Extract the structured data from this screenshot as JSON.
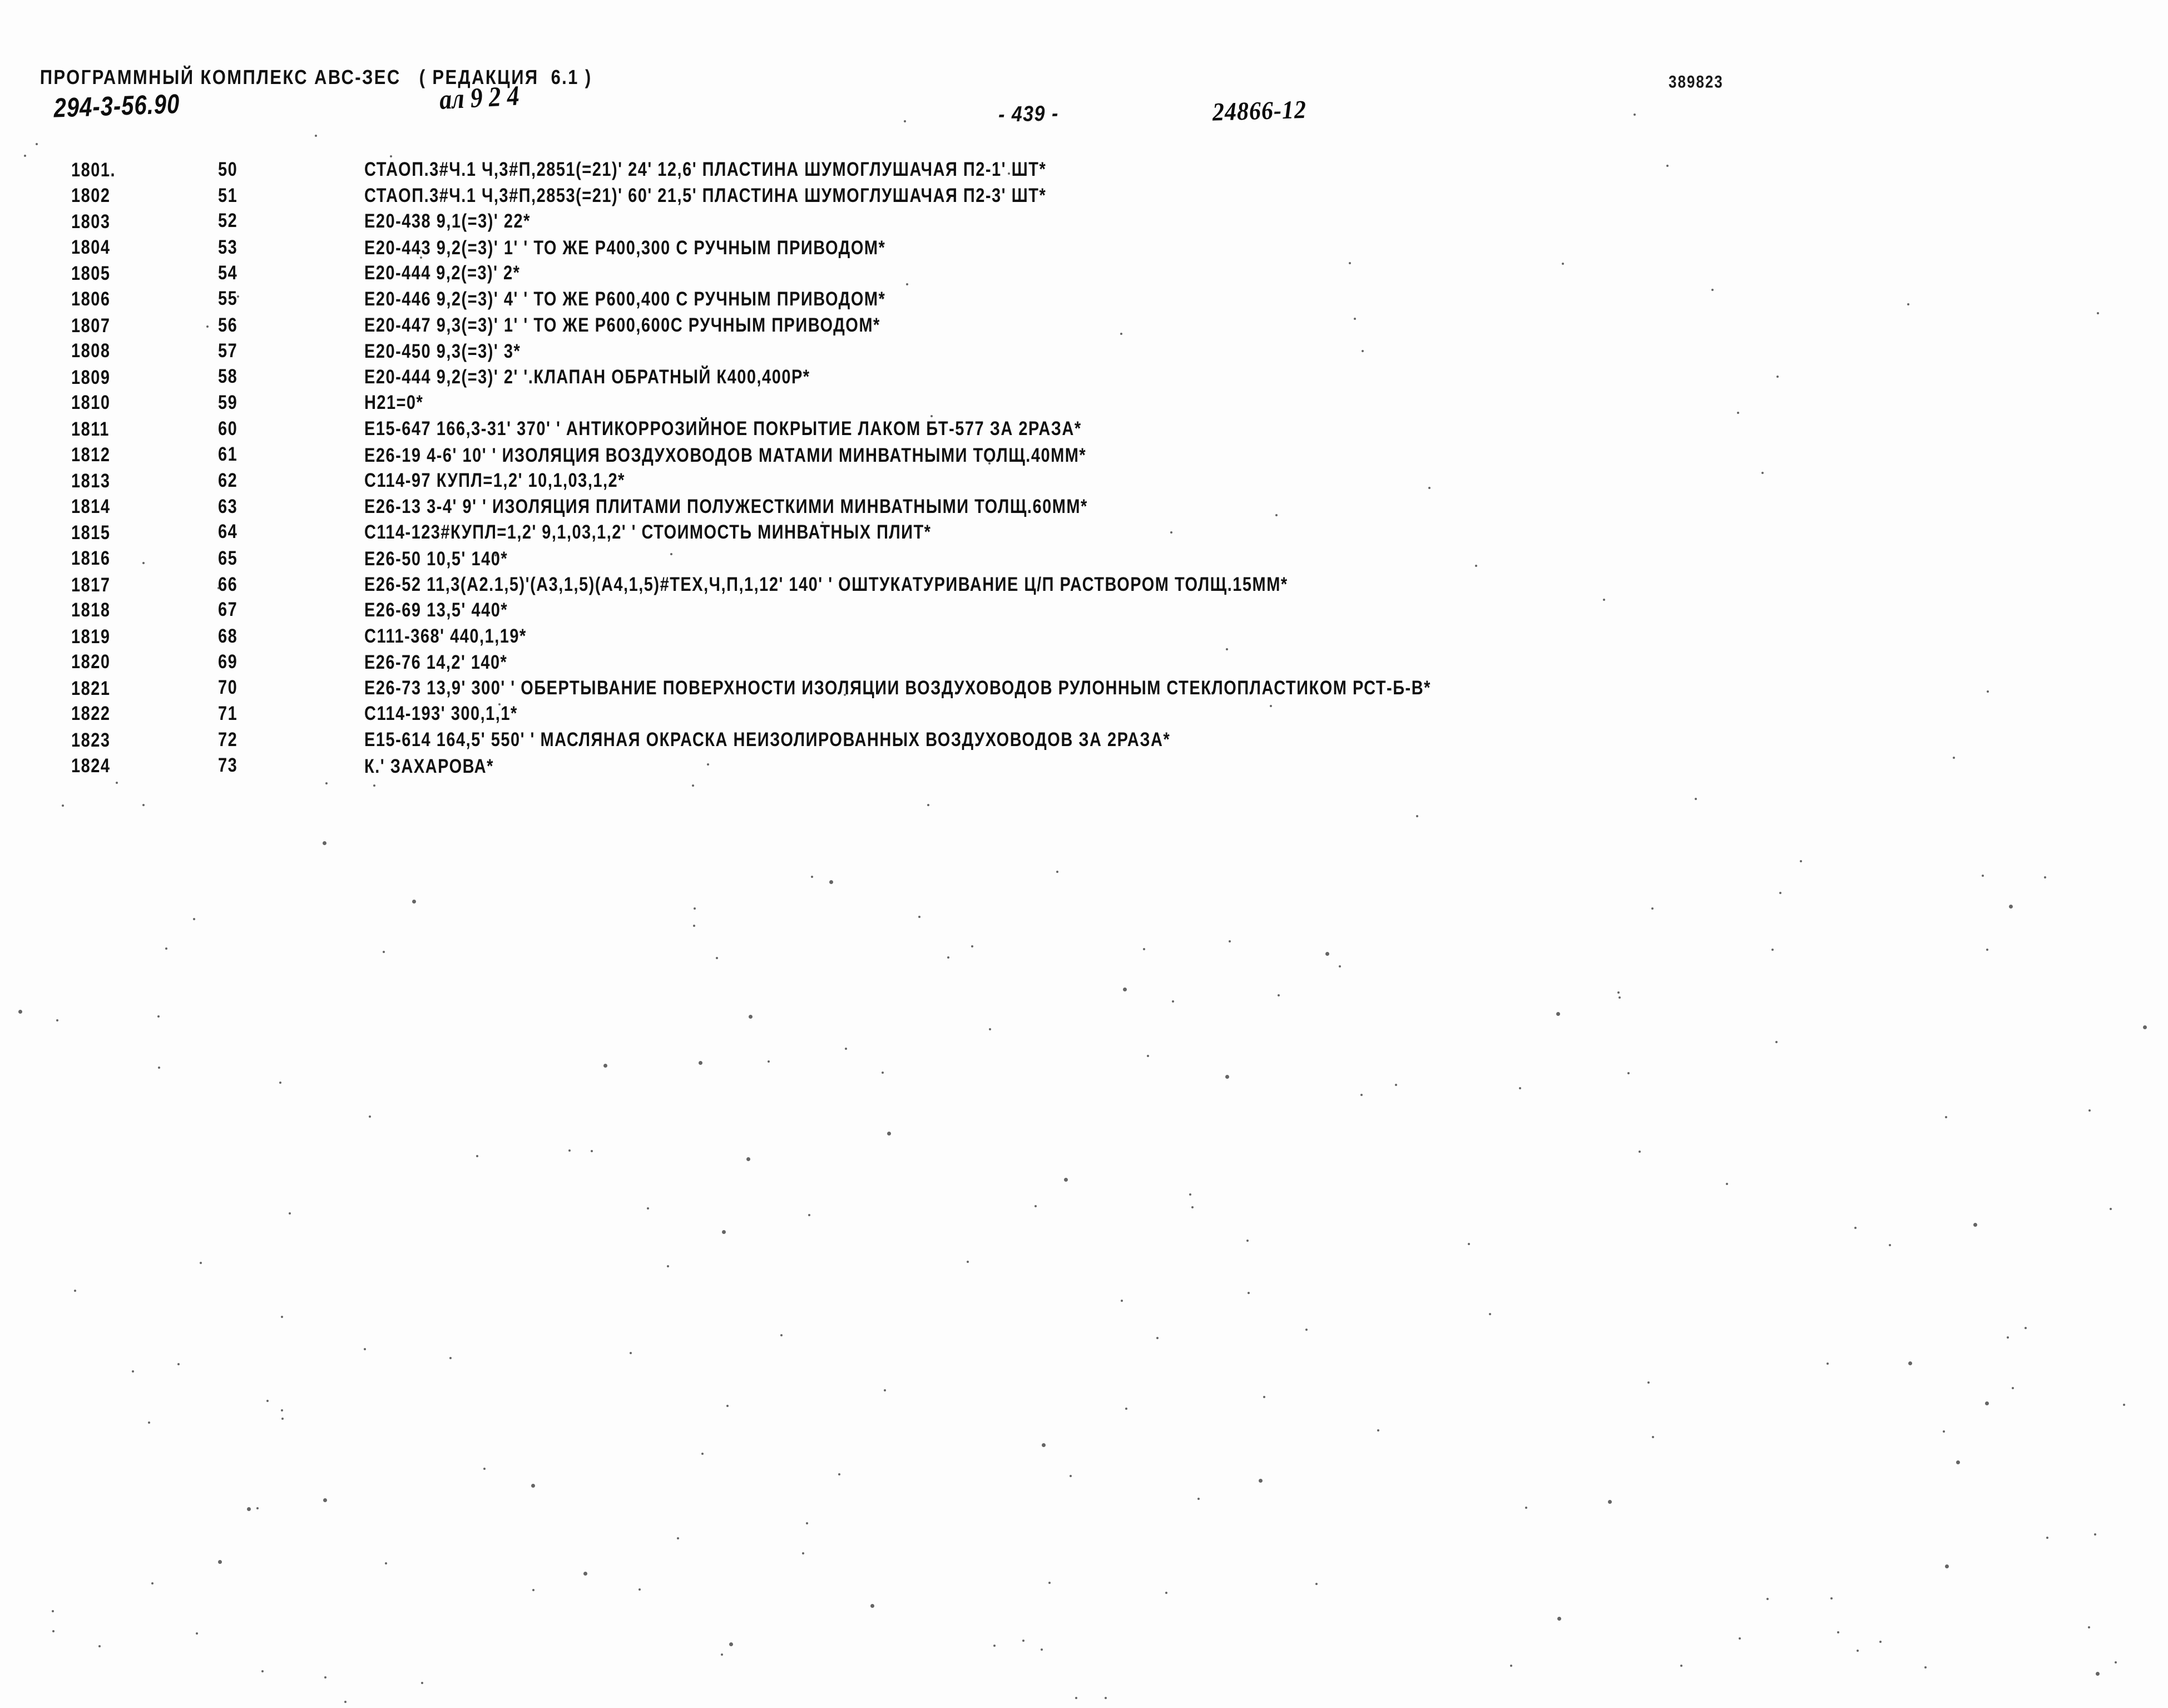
{
  "header": {
    "program_line": "ПРОГРАММНЫЙ КОМПЛЕКС АВС-ЗЕС   ( РЕДАКЦИЯ  6.1 )",
    "document_code": "294-3-56.90",
    "handwritten_note": "ал 9 2 4",
    "page_number": "- 439 -",
    "doc_number": "24866-12",
    "corner_stamp": "389823"
  },
  "listing": {
    "rows": [
      {
        "seq": "1801.",
        "num": "50",
        "body": "СТАОП.3#Ч.1 Ч,3#П,2851(=21)' 24' 12,6' ПЛАСТИНА ШУМОГЛУШАЧАЯ П2-1' ШТ*"
      },
      {
        "seq": "1802",
        "num": "51",
        "body": "СТАОП.3#Ч.1 Ч,3#П,2853(=21)' 60' 21,5' ПЛАСТИНА ШУМОГЛУШАЧАЯ П2-3' ШТ*"
      },
      {
        "seq": "1803",
        "num": "52",
        "body": "Е20-438 9,1(=3)' 22*"
      },
      {
        "seq": "1804",
        "num": "53",
        "body": "Е20-443 9,2(=3)' 1' ' ТО ЖЕ Р400,300 С РУЧНЫМ ПРИВОДОМ*"
      },
      {
        "seq": "1805",
        "num": "54",
        "body": "Е20-444 9,2(=3)' 2*"
      },
      {
        "seq": "1806",
        "num": "55",
        "body": "Е20-446 9,2(=3)' 4' ' ТО ЖЕ Р600,400 С РУЧНЫМ ПРИВОДОМ*"
      },
      {
        "seq": "1807",
        "num": "56",
        "body": "Е20-447 9,3(=3)' 1' ' ТО ЖЕ Р600,600С РУЧНЫМ ПРИВОДОМ*"
      },
      {
        "seq": "1808",
        "num": "57",
        "body": "Е20-450 9,3(=3)' 3*"
      },
      {
        "seq": "1809",
        "num": "58",
        "body": "Е20-444 9,2(=3)' 2' '.КЛАПАН ОБРАТНЫЙ К400,400Р*"
      },
      {
        "seq": "1810",
        "num": "59",
        "body": "Н21=0*"
      },
      {
        "seq": "1811",
        "num": "60",
        "body": "Е15-647 166,3-31' 370' ' АНТИКОРРОЗИЙНОЕ ПОКРЫТИЕ ЛАКОМ БТ-577 ЗА 2РАЗА*"
      },
      {
        "seq": "1812",
        "num": "61",
        "body": "Е26-19 4-6' 10' ' ИЗОЛЯЦИЯ ВОЗДУХОВОДОВ МАТАМИ МИНВАТНЫМИ ТОЛЩ.40ММ*"
      },
      {
        "seq": "1813",
        "num": "62",
        "body": "С114-97 КУПЛ=1,2' 10,1,03,1,2*"
      },
      {
        "seq": "1814",
        "num": "63",
        "body": "Е26-13 3-4' 9' ' ИЗОЛЯЦИЯ ПЛИТАМИ ПОЛУЖЕСТКИМИ МИНВАТНЫМИ ТОЛЩ.60ММ*"
      },
      {
        "seq": "1815",
        "num": "64",
        "body": "С114-123#КУПЛ=1,2' 9,1,03,1,2' ' СТОИМОСТЬ МИНВАТНЫХ ПЛИТ*"
      },
      {
        "seq": "1816",
        "num": "65",
        "body": "Е26-50 10,5' 140*"
      },
      {
        "seq": "1817",
        "num": "66",
        "body": "Е26-52 11,3(А2.1,5)'(А3,1,5)(А4,1,5)#ТЕХ,Ч,П,1,12' 140' ' ОШТУКАТУРИВАНИЕ Ц/П РАСТВОРОМ ТОЛЩ.15ММ*"
      },
      {
        "seq": "1818",
        "num": "67",
        "body": "Е26-69 13,5' 440*"
      },
      {
        "seq": "1819",
        "num": "68",
        "body": "С111-368' 440,1,19*"
      },
      {
        "seq": "1820",
        "num": "69",
        "body": "Е26-76 14,2' 140*"
      },
      {
        "seq": "1821",
        "num": "70",
        "body": "Е26-73 13,9' 300' ' ОБЕРТЫВАНИЕ ПОВЕРХНОСТИ ИЗОЛЯЦИИ ВОЗДУХОВОДОВ РУЛОННЫМ СТЕКЛОПЛАСТИКОМ РСТ-Б-В*"
      },
      {
        "seq": "1822",
        "num": "71",
        "body": "С114-193' 300,1,1*"
      },
      {
        "seq": "1823",
        "num": "72",
        "body": "Е15-614 164,5' 550' ' МАСЛЯНАЯ ОКРАСКА НЕИЗОЛИРОВАННЫХ ВОЗДУХОВОДОВ ЗА 2РАЗА*"
      },
      {
        "seq": "1824",
        "num": "73",
        "body": "К.' ЗАХАРОВА*"
      }
    ]
  }
}
